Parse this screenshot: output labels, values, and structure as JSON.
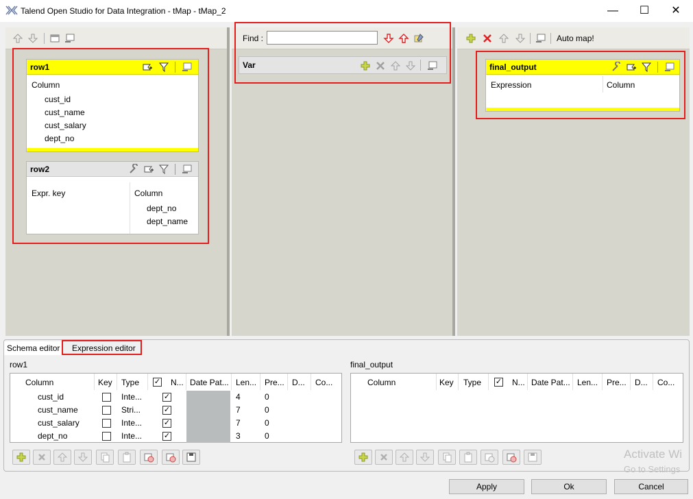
{
  "window": {
    "title": "Talend Open Studio for Data Integration - tMap - tMap_2",
    "minimize": "—",
    "maximize": "☐",
    "close": "✕"
  },
  "center": {
    "find_label": "Find :",
    "find_value": "",
    "var_title": "Var"
  },
  "right": {
    "auto_map": "Auto map!"
  },
  "row1": {
    "name": "row1",
    "column_header": "Column",
    "columns": [
      "cust_id",
      "cust_name",
      "cust_salary",
      "dept_no"
    ]
  },
  "row2": {
    "name": "row2",
    "expr_key_header": "Expr. key",
    "column_header": "Column",
    "columns": [
      "dept_no",
      "dept_name"
    ]
  },
  "final_output": {
    "name": "final_output",
    "expression_header": "Expression",
    "column_header": "Column"
  },
  "bottom": {
    "tabs": [
      "Schema editor",
      "Expression editor"
    ],
    "left_title": "row1",
    "right_title": "final_output",
    "headers": [
      "Column",
      "Key",
      "Type",
      "N...",
      "Date Pat...",
      "Len...",
      "Pre...",
      "D...",
      "Co..."
    ],
    "rows": [
      {
        "column": "cust_id",
        "type": "Inte...",
        "length": "4",
        "precision": "0"
      },
      {
        "column": "cust_name",
        "type": "Stri...",
        "length": "7",
        "precision": "0"
      },
      {
        "column": "cust_salary",
        "type": "Inte...",
        "length": "7",
        "precision": "0"
      },
      {
        "column": "dept_no",
        "type": "Inte...",
        "length": "3",
        "precision": "0"
      }
    ]
  },
  "buttons": {
    "apply": "Apply",
    "ok": "Ok",
    "cancel": "Cancel"
  },
  "watermark": {
    "line1": "Activate Wi",
    "line2": "Go to Settings"
  },
  "colors": {
    "highlight": "#ffff00",
    "annotation": "#e31b1b",
    "pane_bg": "#d6d6cc"
  }
}
